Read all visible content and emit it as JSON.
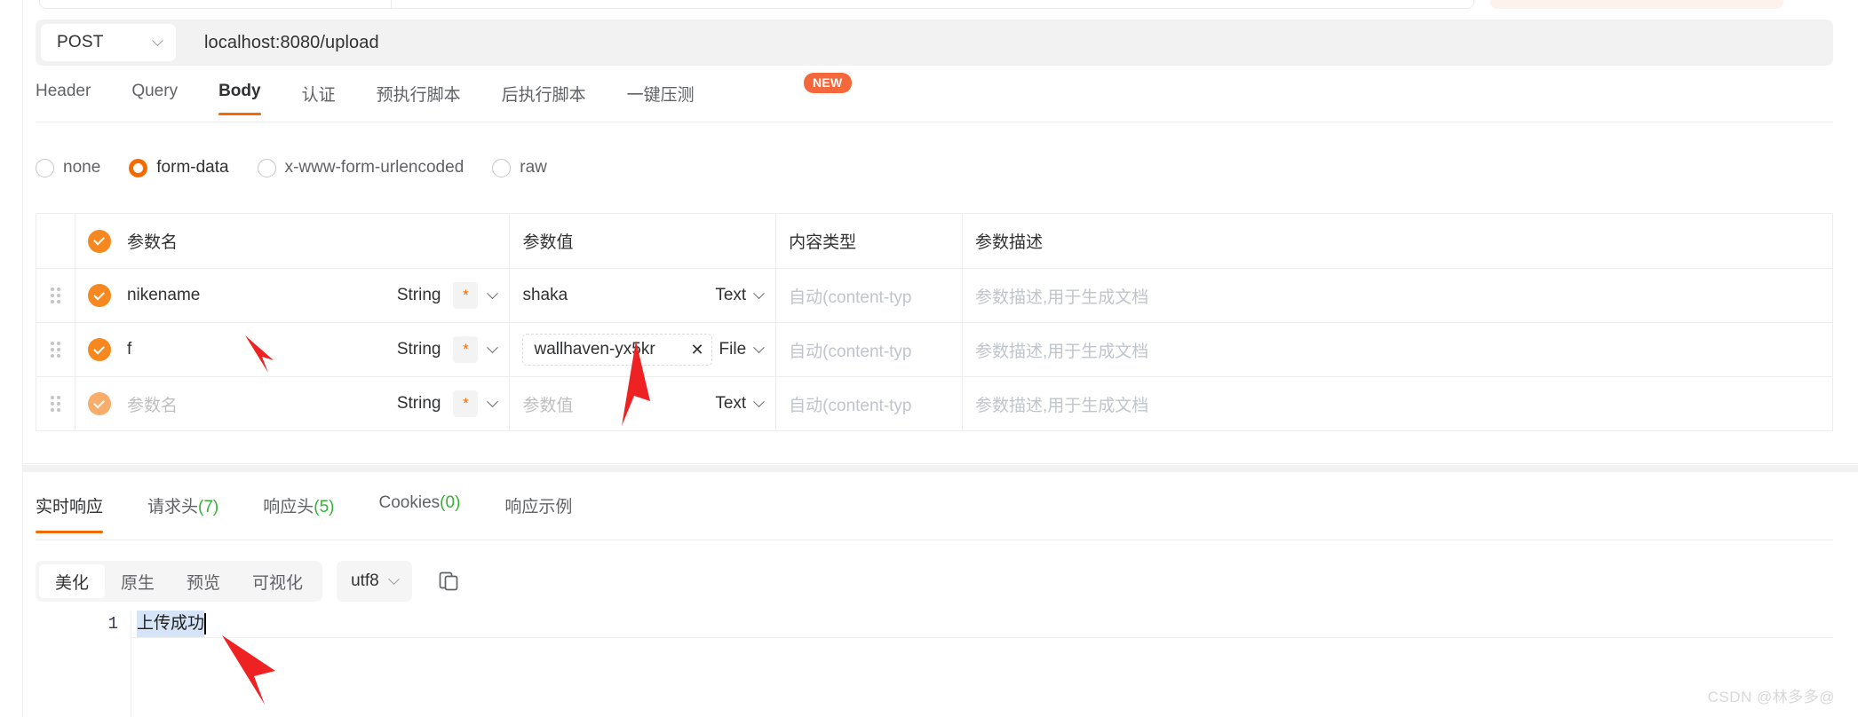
{
  "request": {
    "method": "POST",
    "url": "localhost:8080/upload",
    "tabs": [
      {
        "label": "Header",
        "active": false
      },
      {
        "label": "Query",
        "active": false
      },
      {
        "label": "Body",
        "active": true
      },
      {
        "label": "认证",
        "active": false
      },
      {
        "label": "预执行脚本",
        "active": false
      },
      {
        "label": "后执行脚本",
        "active": false
      },
      {
        "label": "一键压测",
        "active": false
      }
    ],
    "new_badge": "NEW",
    "body_types": [
      {
        "label": "none",
        "checked": false
      },
      {
        "label": "form-data",
        "checked": true
      },
      {
        "label": "x-www-form-urlencoded",
        "checked": false
      },
      {
        "label": "raw",
        "checked": false
      }
    ]
  },
  "params_table": {
    "headers": {
      "name": "参数名",
      "value": "参数值",
      "content_type": "内容类型",
      "description": "参数描述"
    },
    "rows": [
      {
        "name": "nikename",
        "name_placeholder": "",
        "data_type": "String",
        "required_mark": "*",
        "value": "shaka",
        "value_placeholder": "",
        "value_kind": "Text",
        "is_file": false,
        "content_type_placeholder": "自动(content-typ",
        "description_placeholder": "参数描述,用于生成文档"
      },
      {
        "name": "f",
        "name_placeholder": "",
        "data_type": "String",
        "required_mark": "*",
        "value": "wallhaven-yx5kr",
        "value_placeholder": "",
        "value_kind": "File",
        "is_file": true,
        "remove_label": "✕",
        "content_type_placeholder": "自动(content-typ",
        "description_placeholder": "参数描述,用于生成文档"
      },
      {
        "name": "",
        "name_placeholder": "参数名",
        "data_type": "String",
        "required_mark": "*",
        "value": "",
        "value_placeholder": "参数值",
        "value_kind": "Text",
        "is_file": false,
        "content_type_placeholder": "自动(content-typ",
        "description_placeholder": "参数描述,用于生成文档"
      }
    ]
  },
  "response": {
    "tabs": [
      {
        "label": "实时响应",
        "count": "",
        "active": true
      },
      {
        "label": "请求头",
        "count": "(7)",
        "active": false
      },
      {
        "label": "响应头",
        "count": "(5)",
        "active": false
      },
      {
        "label": "Cookies",
        "count": "(0)",
        "active": false
      },
      {
        "label": "响应示例",
        "count": "",
        "active": false
      }
    ],
    "view_modes": [
      {
        "label": "美化",
        "active": true
      },
      {
        "label": "原生",
        "active": false
      },
      {
        "label": "预览",
        "active": false
      },
      {
        "label": "可视化",
        "active": false
      }
    ],
    "encoding": "utf8",
    "copy_icon": "copy-icon",
    "body_lines": [
      {
        "number": "1",
        "text": "上传成功"
      }
    ]
  },
  "watermark": "CSDN @林多多@",
  "colors": {
    "accent": "#f56a00",
    "checkbox": "#f7881f",
    "badge": "#f5683c",
    "count": "#34b233",
    "selection": "#d6e4f7",
    "arrow": "#ee2222"
  }
}
